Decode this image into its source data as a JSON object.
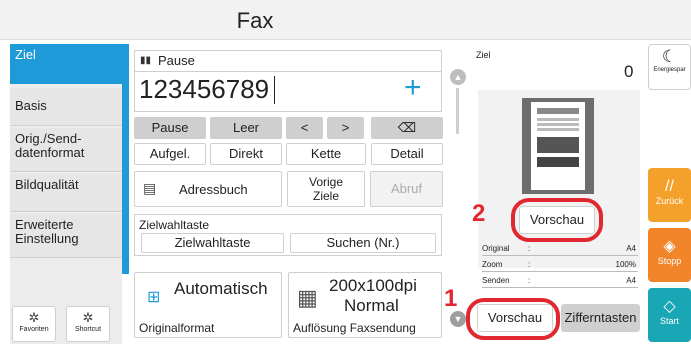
{
  "title": "Fax",
  "sidebar": {
    "items": [
      {
        "label": "Ziel"
      },
      {
        "label": "Basis"
      },
      {
        "label": "Orig./Send-\ndatenformat"
      },
      {
        "label": "Bildqualität"
      },
      {
        "label": "Erweiterte\nEinstellung"
      }
    ],
    "favoriten": "Favoriten",
    "shortcut": "Shortcut"
  },
  "entry": {
    "pause_tag": "Pause",
    "number": "123456789",
    "plus": "+"
  },
  "keys": {
    "pause": "Pause",
    "leer": "Leer",
    "left": "<",
    "right": ">",
    "backspace": "⌫",
    "aufgel": "Aufgel.",
    "direkt": "Direkt",
    "kette": "Kette",
    "detail": "Detail"
  },
  "addressbook": "Adressbuch",
  "vorige_ziele": "Vorige\nZiele",
  "abruf": "Abruf",
  "zielwahl": {
    "heading": "Zielwahltaste",
    "button": "Zielwahltaste",
    "search": "Suchen (Nr.)"
  },
  "orig_format": {
    "value": "Automatisch",
    "label": "Originalformat"
  },
  "resolution": {
    "value1": "200x100dpi",
    "value2": "Normal",
    "label": "Auflösung Faxsendung"
  },
  "preview": {
    "ziel_label": "Ziel",
    "count": "0",
    "vorschau_button": "Vorschau",
    "info": [
      {
        "key": "Original",
        "value": "A4"
      },
      {
        "key": "Zoom",
        "value": "100%"
      },
      {
        "key": "Senden",
        "value": "A4"
      }
    ],
    "bottom_vorschau": "Vorschau",
    "zifferntasten": "Zifferntasten"
  },
  "callouts": {
    "one": "1",
    "two": "2"
  },
  "right_buttons": {
    "energy": "Energiespar",
    "zurueck": "Zurück",
    "stopp": "Stopp",
    "start": "Start"
  },
  "colors": {
    "accent": "#1f9ad8",
    "highlight_ring": "#e0282e",
    "zurueck_btn": "#f3a12a",
    "stopp_btn": "#f2842a",
    "start_btn": "#1aa7b5"
  }
}
